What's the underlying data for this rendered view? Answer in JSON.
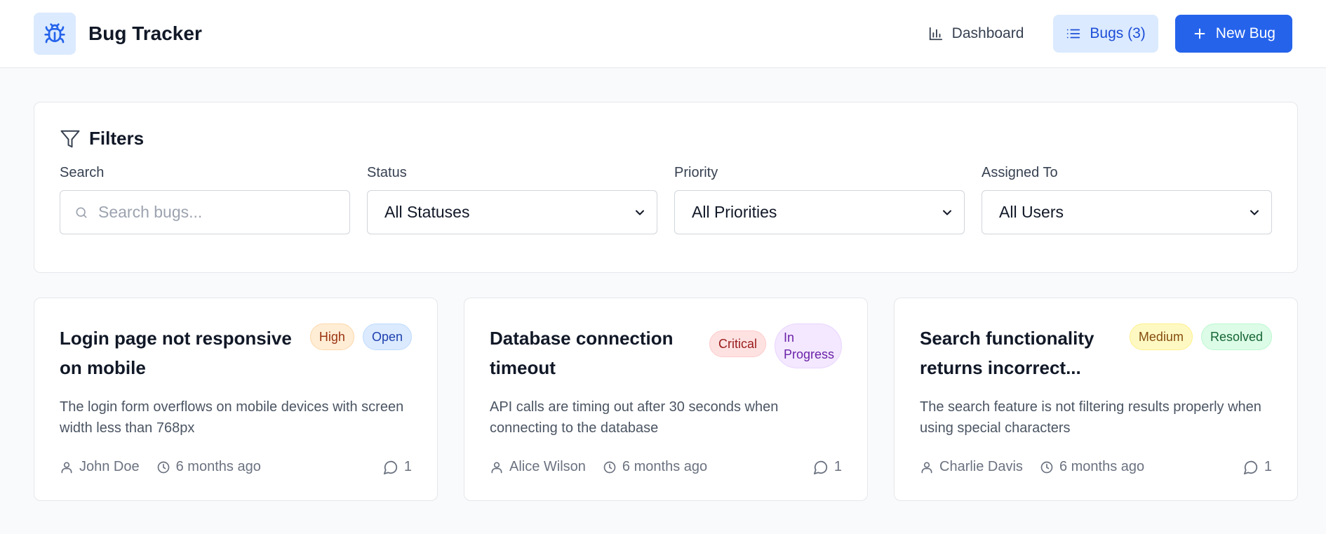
{
  "app": {
    "title": "Bug Tracker"
  },
  "nav": {
    "dashboard_label": "Dashboard",
    "bugs_label": "Bugs (3)",
    "new_bug_label": "New Bug"
  },
  "filters": {
    "title": "Filters",
    "search_label": "Search",
    "search_placeholder": "Search bugs...",
    "status_label": "Status",
    "status_value": "All Statuses",
    "priority_label": "Priority",
    "priority_value": "All Priorities",
    "assigned_label": "Assigned To",
    "assigned_value": "All Users"
  },
  "bugs": [
    {
      "title": "Login page not responsive on mobile",
      "priority": "High",
      "status": "Open",
      "description": "The login form overflows on mobile devices with screen width less than 768px",
      "assignee": "John Doe",
      "time": "6 months ago",
      "comments": "1"
    },
    {
      "title": "Database connection timeout",
      "priority": "Critical",
      "status": "In Progress",
      "description": "API calls are timing out after 30 seconds when connecting to the database",
      "assignee": "Alice Wilson",
      "time": "6 months ago",
      "comments": "1"
    },
    {
      "title": "Search functionality returns incorrect...",
      "priority": "Medium",
      "status": "Resolved",
      "description": "The search feature is not filtering results properly when using special characters",
      "assignee": "Charlie Davis",
      "time": "6 months ago",
      "comments": "1"
    }
  ],
  "colors": {
    "primary": "#2563eb",
    "active_nav_bg": "#dbeafe",
    "page_bg": "#f9fafb"
  },
  "icons": {
    "logo": "bug-icon",
    "dashboard": "bar-chart-icon",
    "bugs": "list-icon",
    "new_bug": "plus-icon",
    "filters": "filter-icon",
    "search": "search-icon",
    "select": "chevron-down-icon",
    "assignee": "user-icon",
    "time": "clock-icon",
    "comments": "comment-icon"
  }
}
